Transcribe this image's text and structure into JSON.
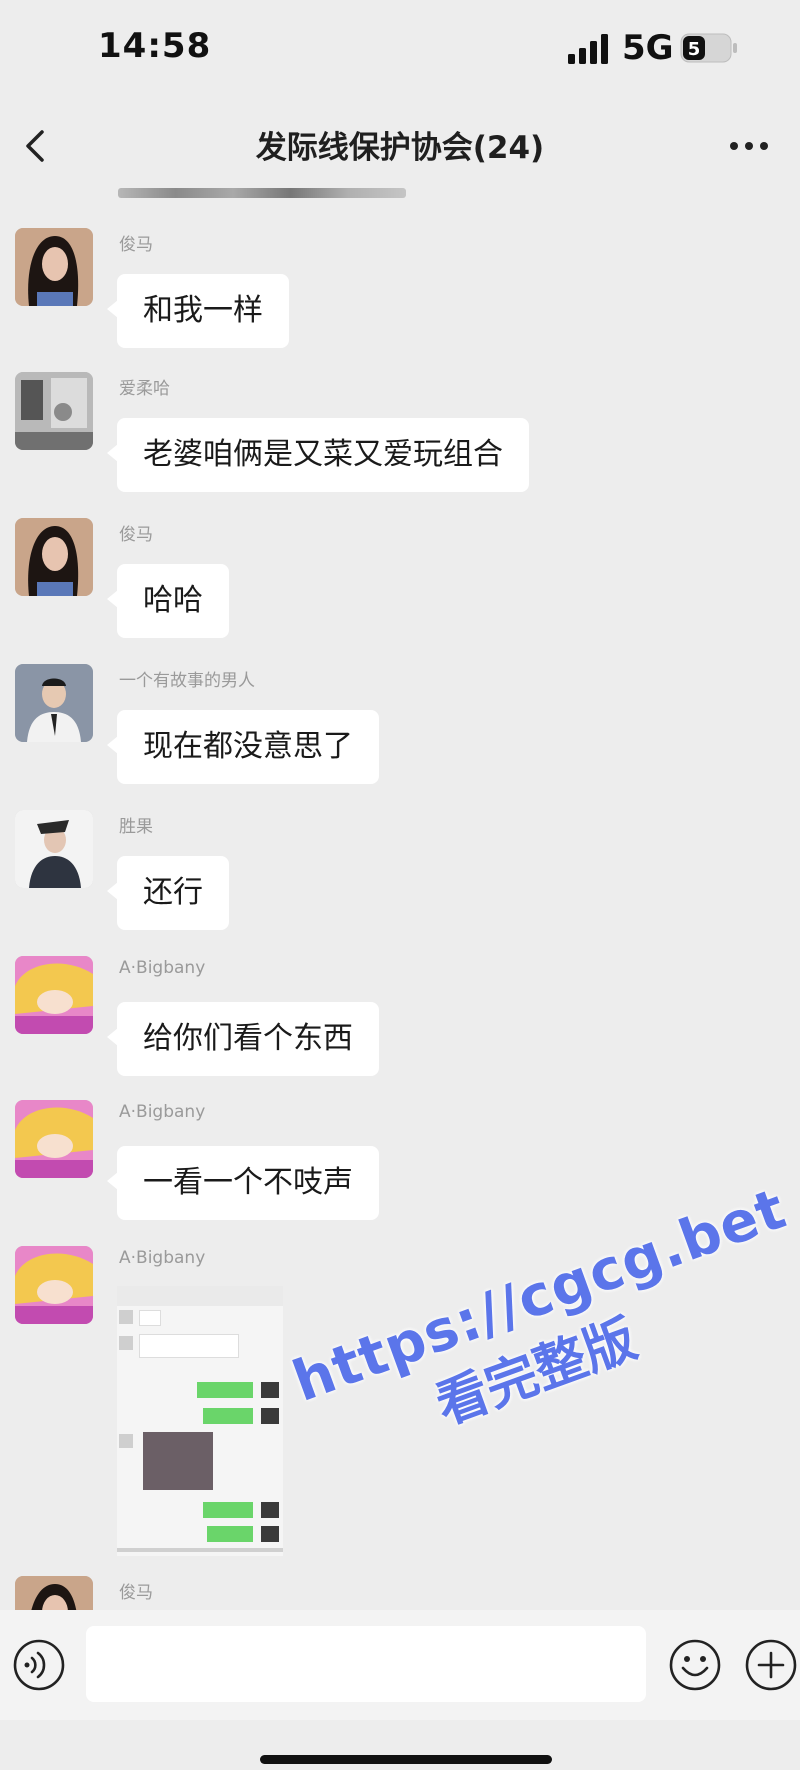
{
  "status_bar": {
    "time": "14:58",
    "network": "5G",
    "battery_level": "5"
  },
  "header": {
    "title": "发际线保护协会(24)"
  },
  "messages": [
    {
      "sender": "俊马",
      "text": "和我一样",
      "avatar": "woman-long-hair-avatar"
    },
    {
      "sender": "爱柔哈",
      "text": "老婆咱俩是又菜又爱玩组合",
      "avatar": "room-photo-avatar"
    },
    {
      "sender": "俊马",
      "text": "哈哈",
      "avatar": "woman-long-hair-avatar"
    },
    {
      "sender": "一个有故事的男人",
      "text": "现在都没意思了",
      "avatar": "man-suit-avatar"
    },
    {
      "sender": "胜果",
      "text": "还行",
      "avatar": "person-portrait-avatar"
    },
    {
      "sender": "A·Bigbany",
      "text": "给你们看个东西",
      "avatar": "anime-blonde-avatar"
    },
    {
      "sender": "A·Bigbany",
      "text": "一看一个不吱声",
      "avatar": "anime-blonde-avatar"
    },
    {
      "sender": "A·Bigbany",
      "image": "chat-screenshot-image",
      "avatar": "anime-blonde-avatar"
    },
    {
      "sender": "俊马",
      "avatar": "woman-long-hair-avatar"
    }
  ],
  "input": {
    "placeholder": ""
  },
  "watermark": {
    "url": "https://cgcg.bet",
    "cta": "看完整版"
  },
  "colors": {
    "background": "#ededed",
    "bubble": "#ffffff",
    "watermark": "#5b75ea",
    "sent_bubble": "#6ad56a"
  }
}
